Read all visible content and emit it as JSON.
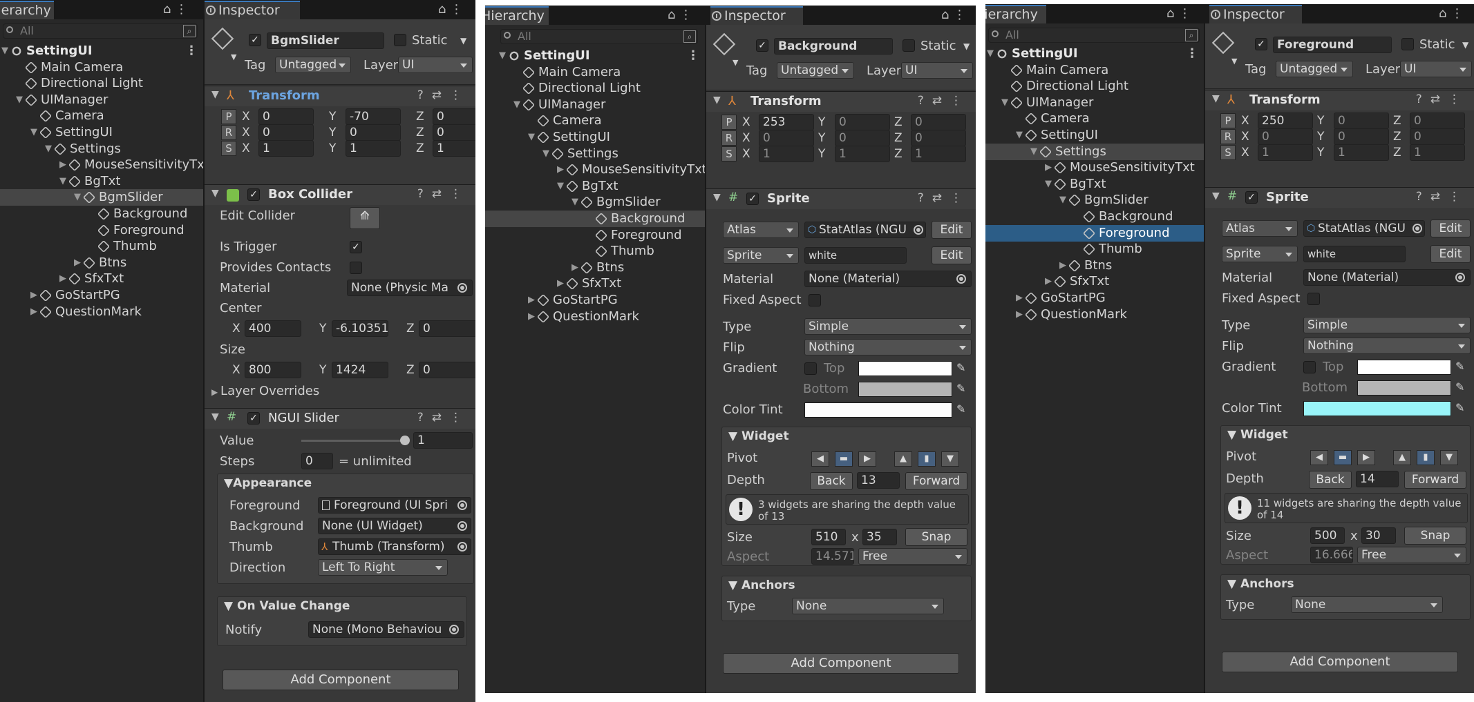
{
  "tabs": {
    "hierarchy": "Hierarchy",
    "inspector": "Inspector"
  },
  "search_placeholder": "All",
  "hierarchy": [
    {
      "label": "SettingUI",
      "depth": 0,
      "arrow": "▼",
      "kind": "scene"
    },
    {
      "label": "Main Camera",
      "depth": 1,
      "arrow": "",
      "kind": "obj"
    },
    {
      "label": "Directional Light",
      "depth": 1,
      "arrow": "",
      "kind": "obj"
    },
    {
      "label": "UIManager",
      "depth": 1,
      "arrow": "▼",
      "kind": "obj"
    },
    {
      "label": "Camera",
      "depth": 2,
      "arrow": "",
      "kind": "obj"
    },
    {
      "label": "SettingUI",
      "depth": 2,
      "arrow": "▼",
      "kind": "obj"
    },
    {
      "label": "Settings",
      "depth": 3,
      "arrow": "▼",
      "kind": "obj"
    },
    {
      "label": "MouseSensitivityTxt",
      "depth": 4,
      "arrow": "▶",
      "kind": "obj"
    },
    {
      "label": "BgTxt",
      "depth": 4,
      "arrow": "▼",
      "kind": "obj"
    },
    {
      "label": "BgmSlider",
      "depth": 5,
      "arrow": "▼",
      "kind": "obj"
    },
    {
      "label": "Background",
      "depth": 6,
      "arrow": "",
      "kind": "obj"
    },
    {
      "label": "Foreground",
      "depth": 6,
      "arrow": "",
      "kind": "obj"
    },
    {
      "label": "Thumb",
      "depth": 6,
      "arrow": "",
      "kind": "obj"
    },
    {
      "label": "Btns",
      "depth": 5,
      "arrow": "▶",
      "kind": "obj"
    },
    {
      "label": "SfxTxt",
      "depth": 4,
      "arrow": "▶",
      "kind": "obj"
    },
    {
      "label": "GoStartPG",
      "depth": 2,
      "arrow": "▶",
      "kind": "obj"
    },
    {
      "label": "QuestionMark",
      "depth": 2,
      "arrow": "▶",
      "kind": "obj"
    }
  ],
  "common": {
    "static": "Static",
    "tag": "Tag",
    "tag_value": "Untagged",
    "layer": "Layer",
    "layer_value": "UI",
    "transform": "Transform",
    "P": "P",
    "R": "R",
    "S": "S",
    "X": "X",
    "Y": "Y",
    "Z": "Z",
    "add_component": "Add Component",
    "sprite": "Sprite",
    "atlas": "Atlas",
    "atlas_value": "StatAtlas (NGU",
    "edit": "Edit",
    "sprite_value": "white",
    "material": "Material",
    "material_value": "None (Material)",
    "fixed_aspect": "Fixed Aspect",
    "type": "Type",
    "type_value": "Simple",
    "flip": "Flip",
    "flip_value": "Nothing",
    "gradient": "Gradient",
    "top": "Top",
    "bottom": "Bottom",
    "color_tint": "Color Tint",
    "widget": "▼ Widget",
    "pivot": "Pivot",
    "depth": "Depth",
    "back": "Back",
    "forward": "Forward",
    "size": "Size",
    "x_sep": "x",
    "snap": "Snap",
    "aspect": "Aspect",
    "aspect_mode": "Free",
    "anchors": "▼ Anchors",
    "anchor_type": "Type",
    "anchor_value": "None"
  },
  "panel1": {
    "object_name": "BgmSlider",
    "pos": [
      "0",
      "-70",
      "0"
    ],
    "rot": [
      "0",
      "0",
      "0"
    ],
    "scale": [
      "1",
      "1",
      "1"
    ],
    "box_collider": "Box Collider",
    "edit_collider": "Edit Collider",
    "is_trigger": "Is Trigger",
    "provides_contacts": "Provides Contacts",
    "material": "Material",
    "material_value": "None (Physic Ma",
    "center": "Center",
    "center_vals": [
      "400",
      "-6.10351",
      "0"
    ],
    "size": "Size",
    "size_vals": [
      "800",
      "1424",
      "0"
    ],
    "layer_overrides": "Layer Overrides",
    "ngui_slider": "NGUI Slider",
    "value_label": "Value",
    "value": "1",
    "value_fraction": 1.0,
    "steps_label": "Steps",
    "steps": "0",
    "steps_note": "= unlimited",
    "appearance": "▼Appearance",
    "foreground": "Foreground",
    "foreground_value": "Foreground (UI Spri",
    "background": "Background",
    "background_value": "None (UI Widget)",
    "thumb": "Thumb",
    "thumb_value": "Thumb (Transform)",
    "direction": "Direction",
    "direction_value": "Left To Right",
    "on_value_change": "▼ On Value Change",
    "notify": "Notify",
    "notify_value": "None (Mono Behaviou"
  },
  "panel2": {
    "object_name": "Background",
    "pos": [
      "253",
      "0",
      "0"
    ],
    "rot": [
      "0",
      "0",
      "0"
    ],
    "scale": [
      "1",
      "1",
      "1"
    ],
    "tint": "#ffffff",
    "depth_value": "13",
    "warning": "3 widgets are sharing the depth value of 13",
    "size_w": "510",
    "size_h": "35",
    "aspect_value": "14.5714"
  },
  "panel3": {
    "object_name": "Foreground",
    "pos": [
      "250",
      "0",
      "0"
    ],
    "rot": [
      "0",
      "0",
      "0"
    ],
    "scale": [
      "1",
      "1",
      "1"
    ],
    "tint": "#99f5f9",
    "depth_value": "14",
    "warning": "11 widgets are sharing the depth value of 14",
    "size_w": "500",
    "size_h": "30",
    "aspect_value": "16.6666"
  }
}
